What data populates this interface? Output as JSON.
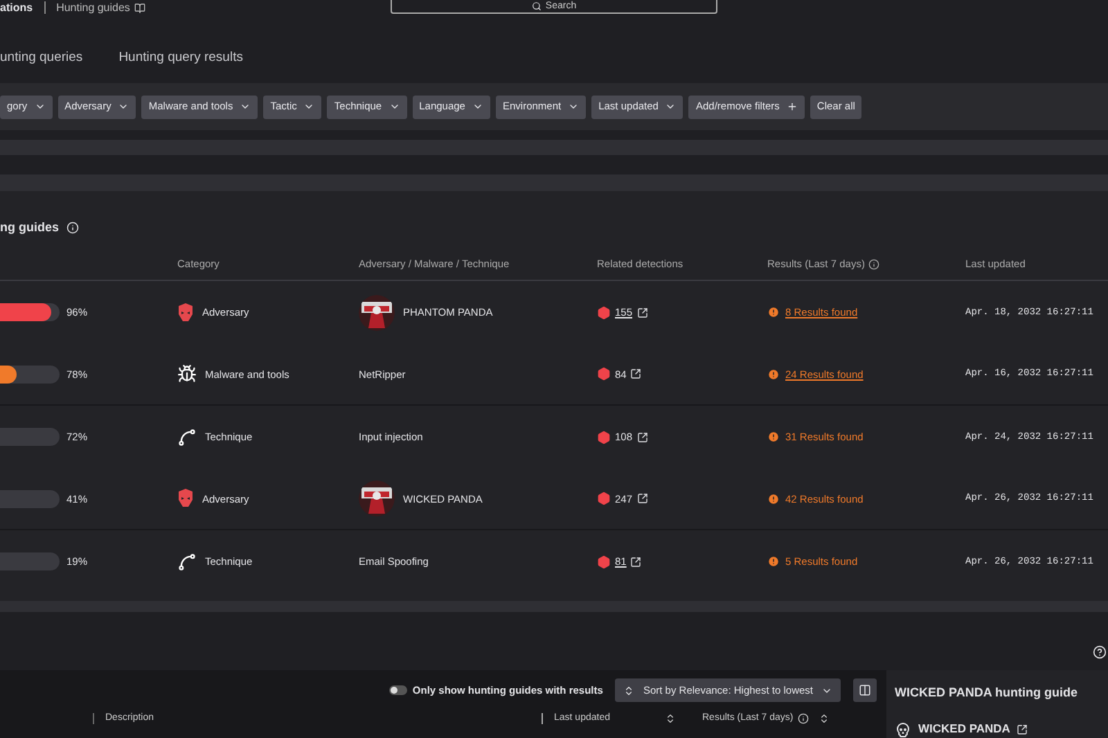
{
  "top_bar": {
    "breadcrumb": [
      "ations",
      "Hunting guides"
    ],
    "search": {
      "placeholder": "Search"
    }
  },
  "tabs": [
    {
      "label": "unting queries",
      "selected": false
    },
    {
      "label": "Hunting query results",
      "selected": false
    }
  ],
  "filters": [
    {
      "label": "gory",
      "kind": "dropdown"
    },
    {
      "label": "Adversary",
      "kind": "dropdown"
    },
    {
      "label": "Malware and tools",
      "kind": "dropdown"
    },
    {
      "label": "Tactic",
      "kind": "dropdown"
    },
    {
      "label": "Technique",
      "kind": "dropdown"
    },
    {
      "label": "Language",
      "kind": "dropdown"
    },
    {
      "label": "Environment",
      "kind": "dropdown"
    },
    {
      "label": "Last updated",
      "kind": "dropdown"
    },
    {
      "label": "Add/remove filters",
      "kind": "add"
    },
    {
      "label": "Clear all",
      "kind": "clear"
    }
  ],
  "section": {
    "title": "ng guides"
  },
  "table": {
    "columns": [
      "Category",
      "Adversary / Malware / Technique",
      "Related detections",
      "Results (Last 7 days)",
      "Last updated"
    ],
    "rows": [
      {
        "level": 0.96,
        "percent": "96%",
        "category": "Adversary",
        "kind": "adversary",
        "subject": "PHANTOM PANDA",
        "avatar": true,
        "detections": "155",
        "detections_link": true,
        "results": "8 Results found",
        "results_link": true,
        "updated": "Apr. 18, 2032 16:27:11"
      },
      {
        "level": 0.78,
        "percent": "78%",
        "category": "Malware and tools",
        "kind": "malware",
        "subject": "NetRipper",
        "avatar": false,
        "detections": "84",
        "detections_link": false,
        "results": "24 Results found",
        "results_link": true,
        "updated": "Apr. 16, 2032 16:27:11"
      },
      {
        "percent": "72%",
        "category": "Technique",
        "kind": "technique",
        "subject": "Input injection",
        "avatar": false,
        "detections": "108",
        "detections_link": false,
        "results": "31 Results found",
        "results_link": false,
        "updated": "Apr. 24, 2032 16:27:11"
      },
      {
        "percent": "41%",
        "category": "Adversary",
        "kind": "adversary",
        "subject": "WICKED PANDA",
        "avatar": true,
        "detections": "247",
        "detections_link": false,
        "results": "42 Results found",
        "results_link": false,
        "updated": "Apr. 26, 2032 16:27:11"
      },
      {
        "percent": "19%",
        "category": "Technique",
        "kind": "technique",
        "subject": "Email Spoofing",
        "avatar": false,
        "detections": "81",
        "detections_link": true,
        "results": "5 Results found",
        "results_link": false,
        "updated": "Apr. 26, 2032 16:27:11"
      }
    ]
  },
  "bottom": {
    "toggle": {
      "label": "Only show hunting guides with results",
      "on": false
    },
    "sort": "Sort by Relevance: Highest to lowest",
    "columns": [
      "Description",
      "Last updated",
      "Results (Last 7 days)"
    ]
  },
  "side_panel": {
    "title": "WICKED PANDA hunting guide",
    "subject": "WICKED PANDA"
  }
}
